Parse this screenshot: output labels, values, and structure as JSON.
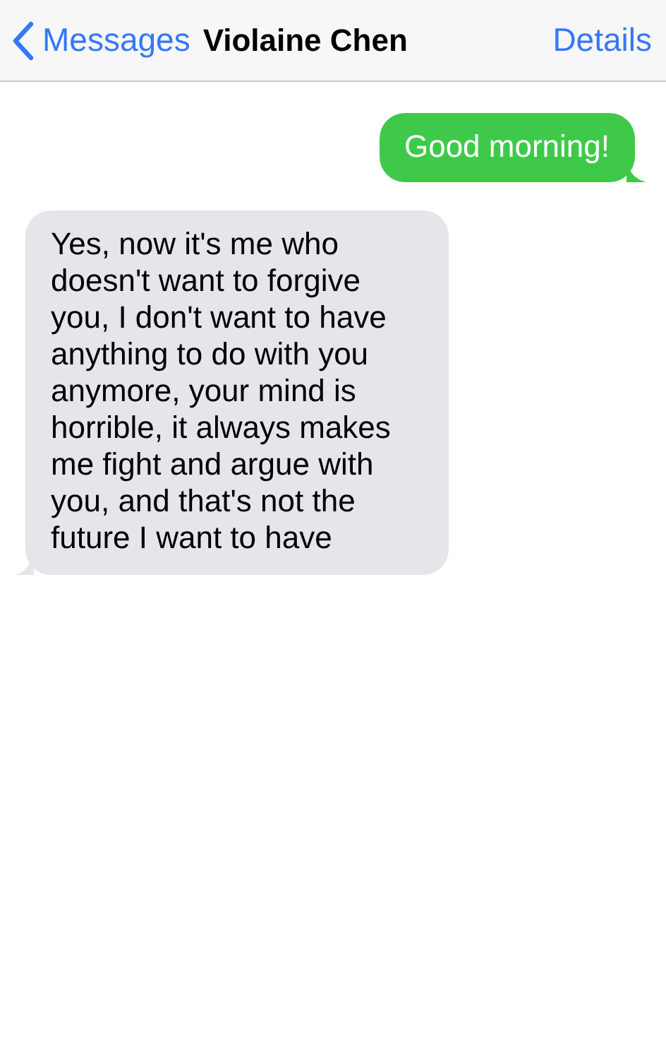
{
  "nav_bar": {
    "back_label": "Messages",
    "title": "Violaine Chen",
    "action": "Details"
  },
  "messages": [
    {
      "kind": "sent",
      "text": "Good morning!"
    },
    {
      "kind": "received",
      "text": "Yes, now it's me who doesn't want to forgive you, I don't want to have anything to do with you anymore, your mind is horrible, it always makes me fight and argue with you, and that's not the future I want to have"
    }
  ]
}
